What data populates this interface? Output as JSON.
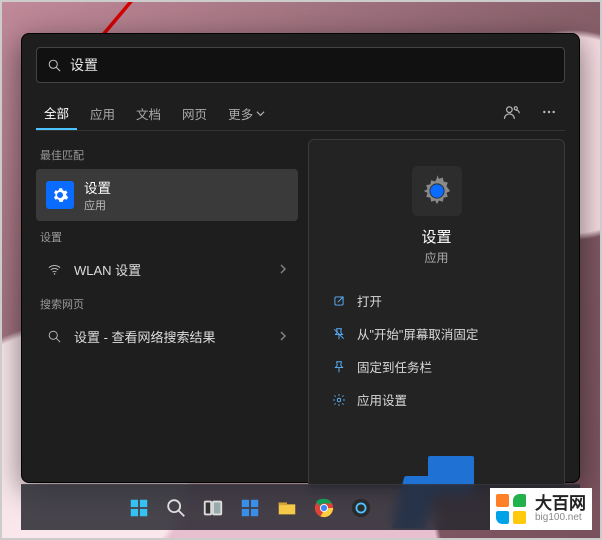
{
  "search": {
    "value": "设置"
  },
  "tabs": {
    "items": [
      "全部",
      "应用",
      "文档",
      "网页",
      "更多"
    ],
    "active_index": 0
  },
  "left": {
    "best_match_label": "最佳匹配",
    "best_match": {
      "title": "设置",
      "subtitle": "应用"
    },
    "settings_label": "设置",
    "settings_item": "WLAN 设置",
    "web_label": "搜索网页",
    "web_item": "设置 - 查看网络搜索结果"
  },
  "detail": {
    "title": "设置",
    "subtitle": "应用",
    "actions": {
      "open": "打开",
      "unpin": "从\"开始\"屏幕取消固定",
      "pin_taskbar": "固定到任务栏",
      "app_settings": "应用设置"
    }
  },
  "watermark": {
    "name": "大百网",
    "domain": "big100.net"
  }
}
